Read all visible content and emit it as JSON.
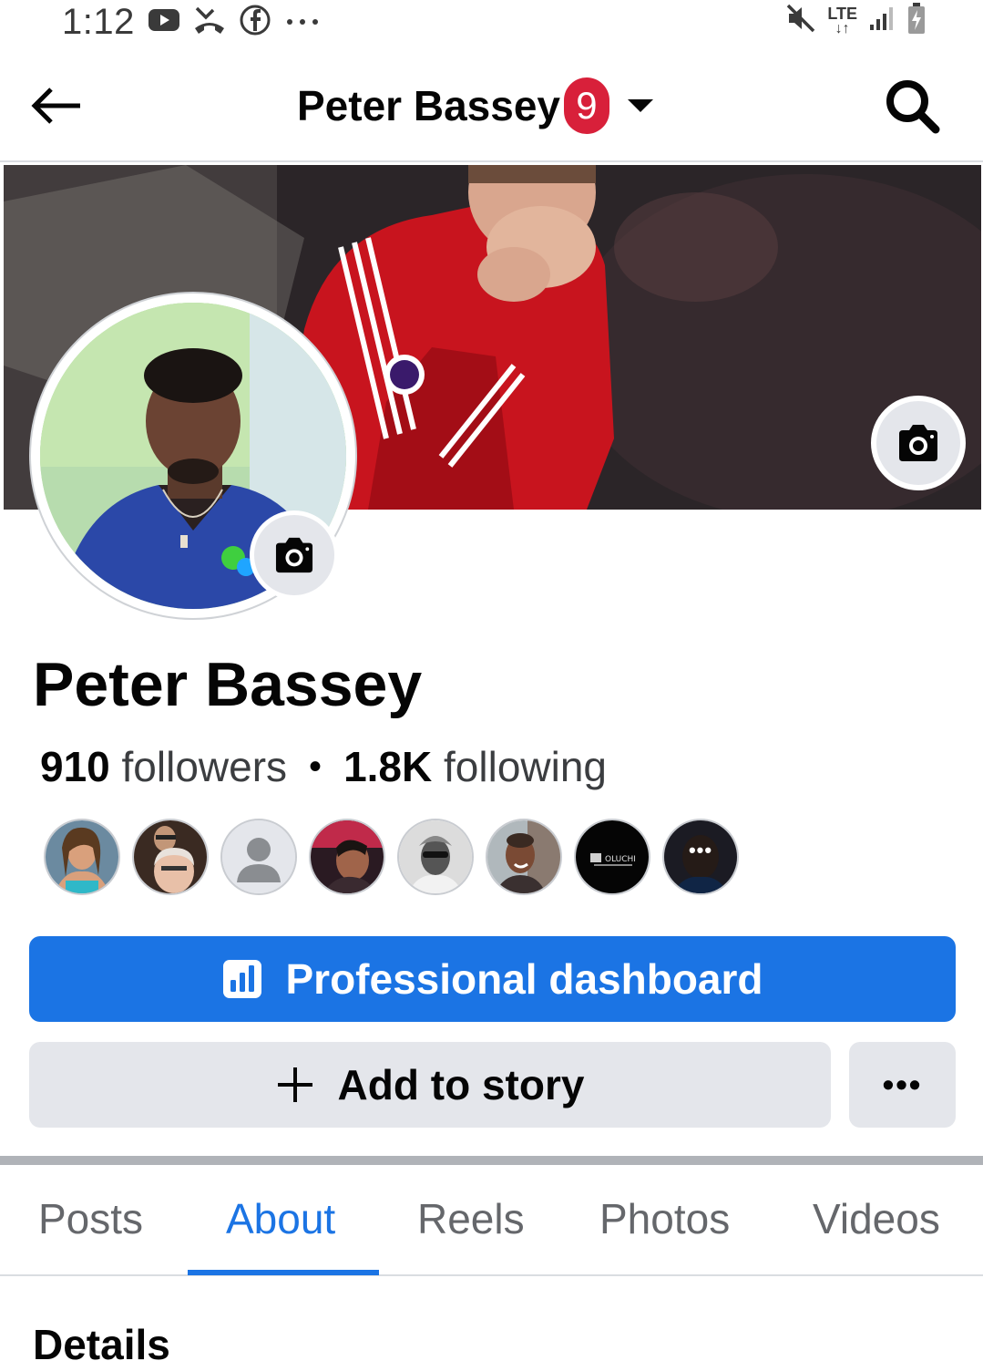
{
  "status_bar": {
    "time": "1:12",
    "left_icons": [
      "youtube-icon",
      "missed-call-icon",
      "facebook-icon",
      "more-dots-icon"
    ],
    "right_icons": [
      "mute-icon",
      "lte-icon",
      "signal-icon",
      "battery-charging-icon"
    ],
    "network_label": "LTE"
  },
  "header": {
    "title": "Peter Bassey",
    "badge_count": "9"
  },
  "profile": {
    "name": "Peter Bassey",
    "followers_count": "910",
    "followers_label": "followers",
    "following_count": "1.8K",
    "following_label": "following",
    "more_friends_glyph": "•••"
  },
  "buttons": {
    "professional_dashboard": "Professional dashboard",
    "add_to_story": "Add to story",
    "more": "•••"
  },
  "tabs": [
    {
      "label": "Posts",
      "active": false
    },
    {
      "label": "About",
      "active": true
    },
    {
      "label": "Reels",
      "active": false
    },
    {
      "label": "Photos",
      "active": false
    },
    {
      "label": "Videos",
      "active": false
    }
  ],
  "details_heading": "Details",
  "colors": {
    "brand_blue": "#1b74e4",
    "badge_red": "#d8203a",
    "button_grey": "#e4e6eb",
    "text_secondary": "#65676b"
  }
}
